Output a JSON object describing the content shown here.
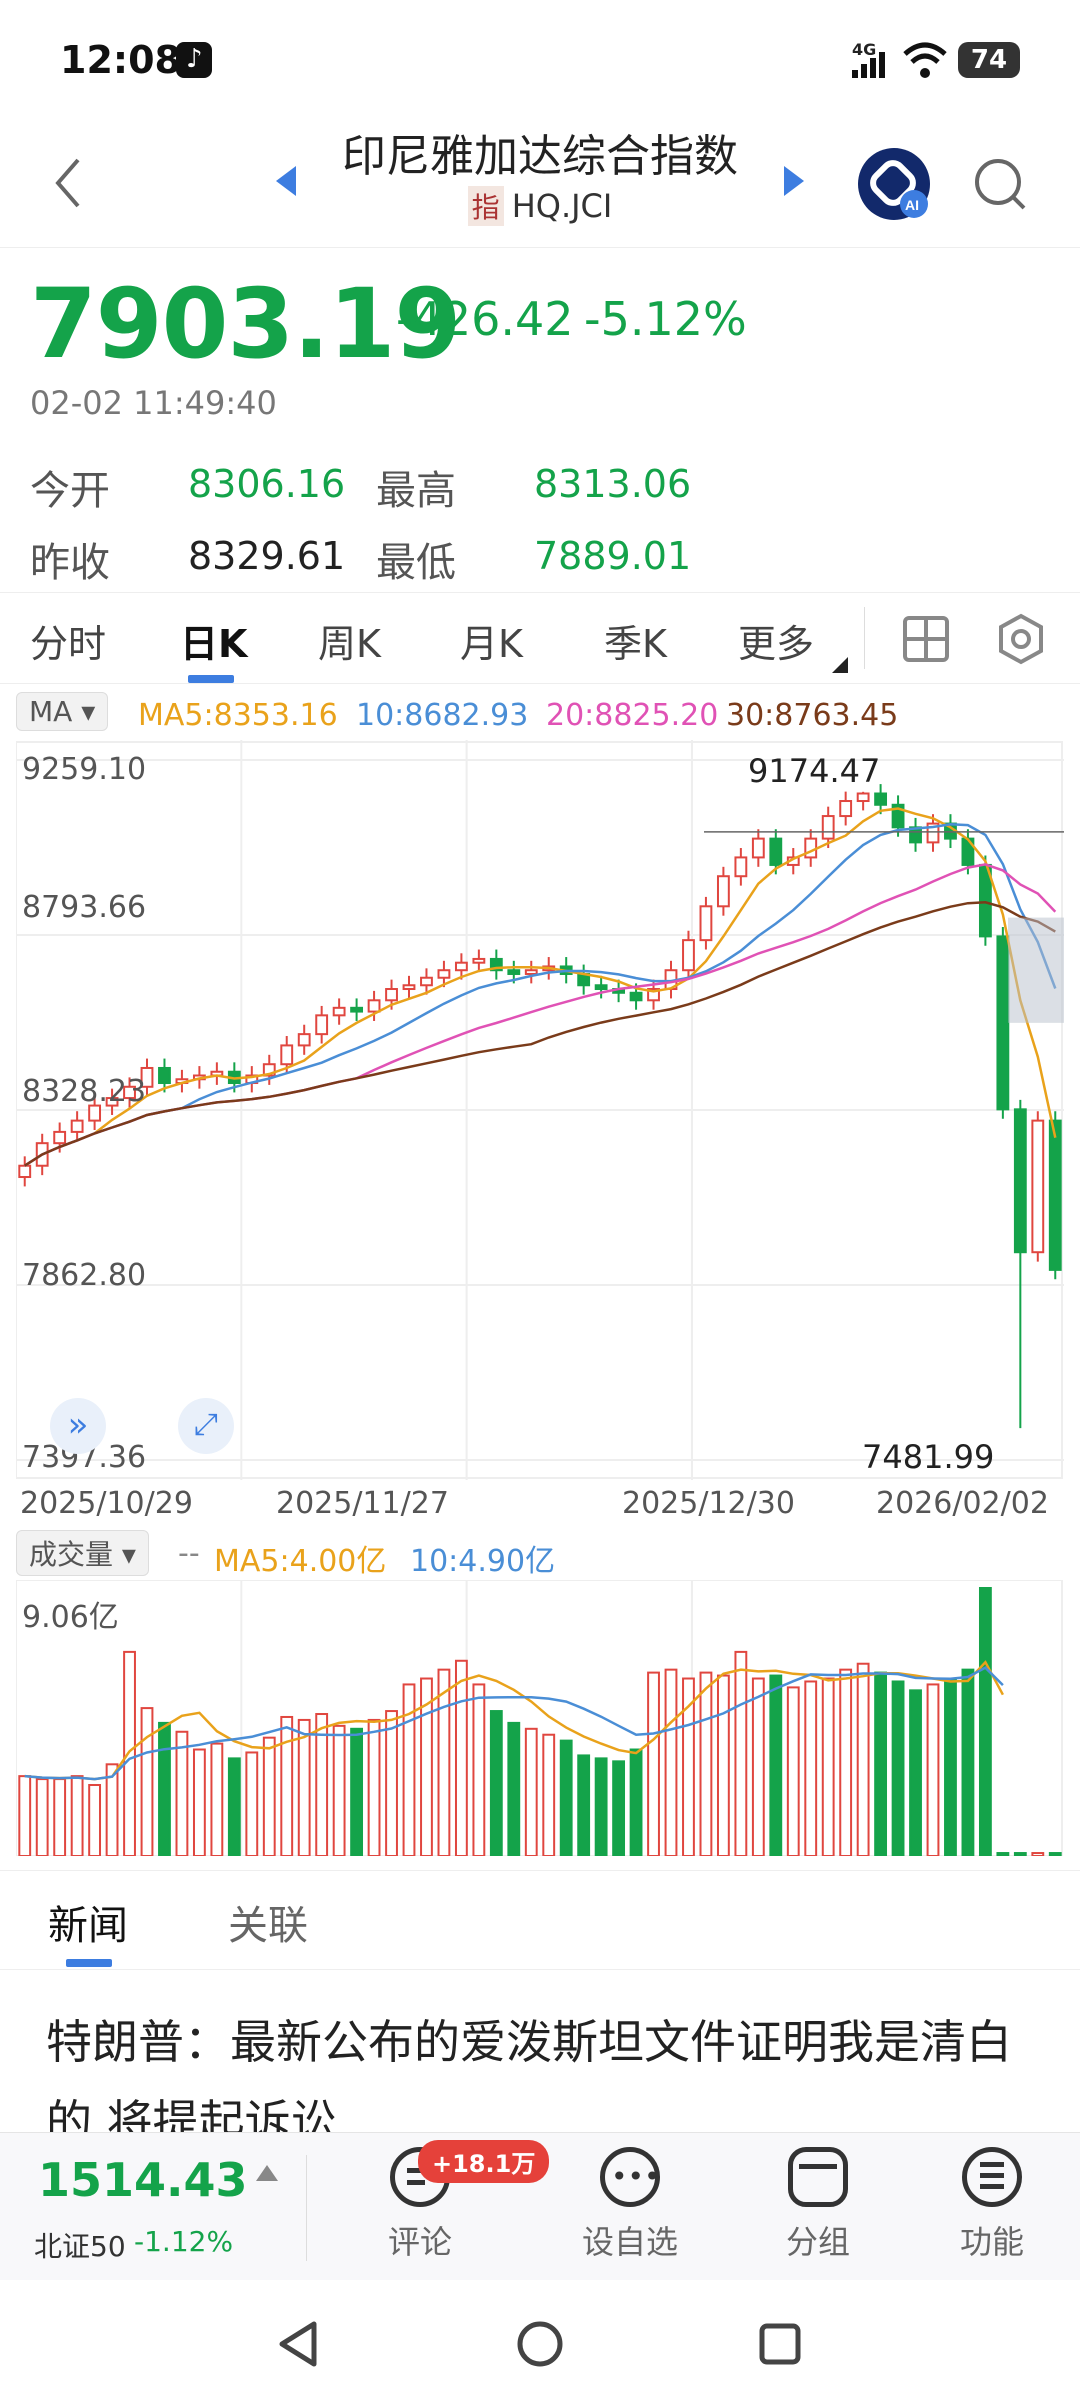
{
  "status_bar": {
    "time": "12:08",
    "network": "4G",
    "battery": "74"
  },
  "header": {
    "title": "印尼雅加达综合指数",
    "tag": "指",
    "code": "HQ.JCI"
  },
  "quote": {
    "price": "7903.19",
    "change": "-426.42",
    "change_pct": "-5.12%",
    "timestamp": "02-02 11:49:40",
    "open_label": "今开",
    "open": "8306.16",
    "high_label": "最高",
    "high": "8313.06",
    "prev_label": "昨收",
    "prev": "8329.61",
    "low_label": "最低",
    "low": "7889.01"
  },
  "tabs": [
    {
      "label": "分时"
    },
    {
      "label": "日K"
    },
    {
      "label": "周K"
    },
    {
      "label": "月K"
    },
    {
      "label": "季K"
    },
    {
      "label": "更多"
    }
  ],
  "chart": {
    "ma_selector": "MA",
    "ma5": "MA5:8353.16",
    "ma10": "10:8682.93",
    "ma20": "20:8825.20",
    "ma30": "30:8763.45",
    "y_labels": [
      "9259.10",
      "8793.66",
      "8328.23",
      "7862.80",
      "7397.36"
    ],
    "x_labels": [
      "2025/10/29",
      "2025/11/27",
      "2025/12/30",
      "2026/02/02"
    ],
    "high_mark": "9174.47",
    "low_mark": "7481.99"
  },
  "volume": {
    "selector": "成交量",
    "dash": "--",
    "ma5": "MA5:4.00亿",
    "ma10": "10:4.90亿",
    "max_label": "9.06亿"
  },
  "chart_data": {
    "type": "candlestick",
    "ylim": [
      7397.36,
      9259.1
    ],
    "yticks": [
      9259.1,
      8793.66,
      8328.23,
      7862.8,
      7397.36
    ],
    "x_ticks": [
      "2025/10/29",
      "2025/11/27",
      "2025/12/30",
      "2026/02/02"
    ],
    "close": [
      8180,
      8240,
      8270,
      8300,
      8340,
      8360,
      8390,
      8440,
      8400,
      8410,
      8420,
      8430,
      8400,
      8420,
      8450,
      8500,
      8530,
      8580,
      8600,
      8590,
      8620,
      8650,
      8660,
      8680,
      8700,
      8720,
      8730,
      8700,
      8690,
      8700,
      8710,
      8690,
      8660,
      8650,
      8640,
      8620,
      8650,
      8700,
      8780,
      8870,
      8950,
      9000,
      9050,
      8980,
      9000,
      9050,
      9110,
      9150,
      9170,
      9140,
      9080,
      9040,
      9090,
      9050,
      8980,
      8790,
      8330,
      7950,
      8300,
      7903
    ],
    "volume_max": 9.06,
    "volume": [
      2.7,
      2.6,
      2.6,
      2.7,
      2.4,
      3.1,
      6.9,
      5.0,
      4.5,
      4.2,
      3.6,
      3.8,
      3.3,
      3.5,
      4.0,
      4.7,
      4.6,
      4.8,
      4.4,
      4.3,
      4.6,
      4.9,
      5.8,
      6.0,
      6.3,
      6.6,
      5.8,
      4.9,
      4.5,
      4.3,
      4.1,
      3.9,
      3.4,
      3.3,
      3.2,
      3.6,
      6.2,
      6.3,
      6.0,
      6.2,
      6.1,
      6.9,
      6.0,
      6.1,
      5.7,
      5.9,
      6.0,
      6.3,
      6.5,
      6.2,
      5.9,
      5.6,
      5.8,
      6.0,
      6.3,
      9.06,
      0.1,
      0.1,
      0.1,
      0.1
    ],
    "ma5_label": "MA5:8353.16",
    "ma10_label": "10:8682.93",
    "ma20_label": "20:8825.20",
    "ma30_label": "30:8763.45",
    "high": 9174.47,
    "low": 7481.99
  },
  "news": {
    "tabs": [
      "新闻",
      "关联"
    ],
    "headline": "特朗普：最新公布的爱泼斯坦文件证明我是清白的 将提起诉讼"
  },
  "bottom": {
    "index_value": "1514.43",
    "index_name": "北证50",
    "index_change": "-1.12%",
    "badge": "+18.1万",
    "buttons": [
      "评论",
      "设自选",
      "分组",
      "功能"
    ]
  },
  "colors": {
    "up": "#e0463f",
    "down": "#14a34a",
    "ma5": "#e9a21b",
    "ma10": "#4a8ed6",
    "ma20": "#e052b5",
    "ma30": "#7a3b1a",
    "accent": "#3d7de0"
  }
}
